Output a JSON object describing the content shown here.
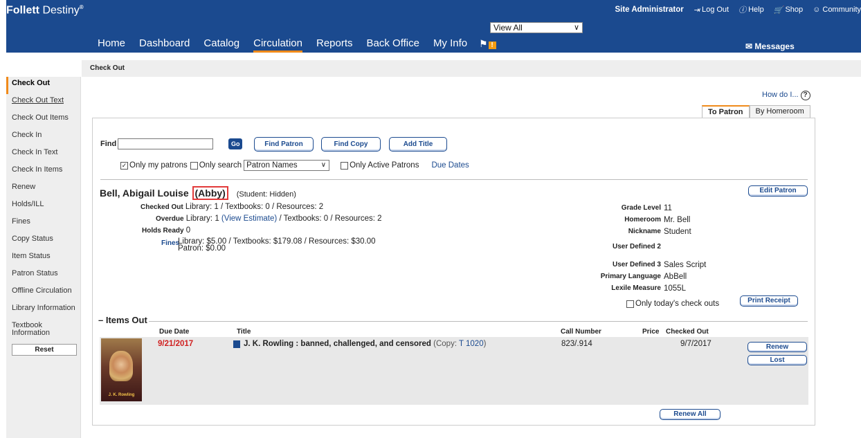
{
  "header": {
    "logo_bold": "Follett",
    "logo_rest": " Destiny",
    "logo_mark": "®",
    "view_select": "View All",
    "user": "Site Administrator",
    "logout": "Log Out",
    "help": "Help",
    "shop": "Shop",
    "community": "Community",
    "messages": "Messages"
  },
  "nav": {
    "items": [
      "Home",
      "Dashboard",
      "Catalog",
      "Circulation",
      "Reports",
      "Back Office",
      "My Info"
    ],
    "active": "Circulation",
    "alert_badge": "!"
  },
  "subbar": {
    "title": "Check Out"
  },
  "sidebar": {
    "items": [
      "Check Out",
      "Check Out Text",
      "Check Out Items",
      "Check In",
      "Check In Text",
      "Check In Items",
      "Renew",
      "Holds/ILL",
      "Fines",
      "Copy Status",
      "Item Status",
      "Patron Status",
      "Offline Circulation",
      "Library Information",
      "Textbook Information"
    ],
    "reset": "Reset"
  },
  "howdo": "How do I...",
  "tabs": {
    "to_patron": "To Patron",
    "by_homeroom": "By Homeroom"
  },
  "find": {
    "label": "Find",
    "value": "",
    "go": "Go",
    "find_patron": "Find Patron",
    "find_copy": "Find Copy",
    "add_title": "Add Title",
    "only_my_patrons": "Only my patrons",
    "only_search": "Only search",
    "search_type": "Patron Names",
    "only_active": "Only Active Patrons",
    "due_dates": "Due Dates"
  },
  "patron": {
    "name": "Bell, Abigail Louise",
    "nickname": "(Abby)",
    "status": "(Student: Hidden)",
    "edit": "Edit Patron",
    "checked_out_label": "Checked Out",
    "checked_out_value": "Library: 1 / Textbooks: 0 / Resources: 2",
    "overdue_label": "Overdue",
    "overdue_lib": "Library: 1",
    "overdue_link": "(View Estimate)",
    "overdue_rest": "/ Textbooks: 0 / Resources: 2",
    "holds_label": "Holds Ready",
    "holds_value": "0",
    "fines_label": "Fines",
    "fines_line1": "Library: $5.00 / Textbooks: $179.08 / Resources: $30.00",
    "fines_line2": "Patron: $0.00",
    "details": [
      {
        "k": "Grade Level",
        "v": "11"
      },
      {
        "k": "Homeroom",
        "v": "Mr. Bell"
      },
      {
        "k": "Nickname",
        "v": "Student"
      },
      {
        "k": "",
        "v": ""
      },
      {
        "k": "User Defined 2",
        "v": ""
      },
      {
        "k": "",
        "v": ""
      },
      {
        "k": "User Defined 3",
        "v": "Sales Script"
      },
      {
        "k": "Primary Language",
        "v": "AbBell"
      },
      {
        "k": "Lexile Measure",
        "v": "1055L"
      }
    ],
    "only_today": "Only today's check outs",
    "print_receipt": "Print Receipt"
  },
  "items_out": {
    "header": "Items Out",
    "columns": {
      "due": "Due Date",
      "title": "Title",
      "call": "Call Number",
      "price": "Price",
      "checked": "Checked Out"
    },
    "rows": [
      {
        "due": "9/21/2017",
        "title": "J. K. Rowling : banned, challenged, and censored",
        "copy_pre": "(Copy: ",
        "copy": "T 1020",
        "copy_post": ")",
        "call": "823/.914",
        "price": "",
        "checked": "9/7/2017",
        "cover_text": "J. K. Rowling"
      }
    ],
    "renew": "Renew",
    "lost": "Lost",
    "renew_all": "Renew All"
  }
}
